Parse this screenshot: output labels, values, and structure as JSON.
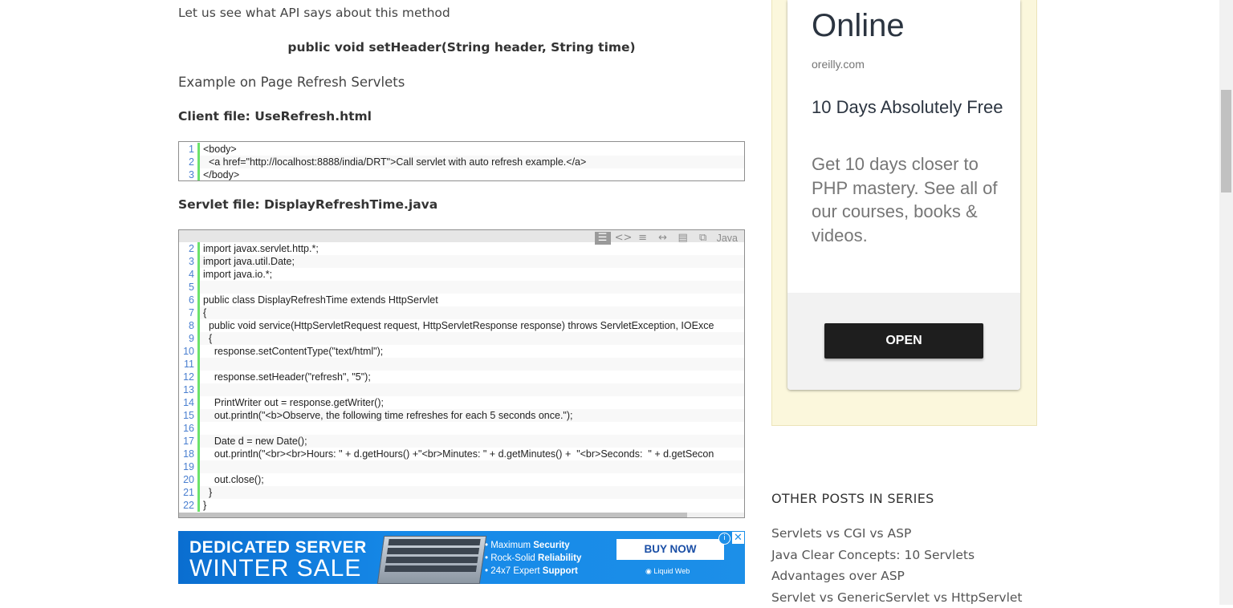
{
  "article": {
    "intro": "Let us see what API says about this method",
    "signature": "public void setHeader(String header, String time)",
    "example_heading": "Example on Page Refresh Servlets",
    "client_heading": "Client file: UseRefresh.html",
    "servlet_heading": "Servlet file: DisplayRefreshTime.java"
  },
  "client_code": [
    {
      "n": "1",
      "text": "<body>"
    },
    {
      "n": "2",
      "text": "  <a href=\"http://localhost:8888/india/DRT\">Call servlet with auto refresh example.</a>"
    },
    {
      "n": "3",
      "text": "</body>"
    }
  ],
  "servlet_toolbar": {
    "language": "Java",
    "icons": [
      "view-source-icon",
      "code-icon",
      "wrap-icon",
      "expand-icon",
      "copy-icon",
      "popup-icon"
    ]
  },
  "servlet_code": [
    {
      "n": "2",
      "text": "import javax.servlet.http.*;"
    },
    {
      "n": "3",
      "text": "import java.util.Date;"
    },
    {
      "n": "4",
      "text": "import java.io.*;"
    },
    {
      "n": "5",
      "text": ""
    },
    {
      "n": "6",
      "text": "public class DisplayRefreshTime extends HttpServlet"
    },
    {
      "n": "7",
      "text": "{"
    },
    {
      "n": "8",
      "text": "  public void service(HttpServletRequest request, HttpServletResponse response) throws ServletException, IOExce"
    },
    {
      "n": "9",
      "text": "  {"
    },
    {
      "n": "10",
      "text": "    response.setContentType(\"text/html\");"
    },
    {
      "n": "11",
      "text": ""
    },
    {
      "n": "12",
      "text": "    response.setHeader(\"refresh\", \"5\");"
    },
    {
      "n": "13",
      "text": ""
    },
    {
      "n": "14",
      "text": "    PrintWriter out = response.getWriter();"
    },
    {
      "n": "15",
      "text": "    out.println(\"<b>Observe, the following time refreshes for each 5 seconds once.\");"
    },
    {
      "n": "16",
      "text": ""
    },
    {
      "n": "17",
      "text": "    Date d = new Date();"
    },
    {
      "n": "18",
      "text": "    out.println(\"<br><br>Hours: \" + d.getHours() +\"<br>Minutes: \" + d.getMinutes() +  \"<br>Seconds:  \" + d.getSecon"
    },
    {
      "n": "19",
      "text": ""
    },
    {
      "n": "20",
      "text": "    out.close();"
    },
    {
      "n": "21",
      "text": "  }"
    },
    {
      "n": "22",
      "text": "}"
    }
  ],
  "ad_banner": {
    "title_line1": "DEDICATED SERVER",
    "title_line2": "WINTER SALE",
    "bullet1_pre": "• Maximum ",
    "bullet1_bold": "Security",
    "bullet2_pre": "• Rock-Solid ",
    "bullet2_bold": "Reliability",
    "bullet3_pre": "• 24x7 Expert ",
    "bullet3_bold": "Support",
    "cta": "BUY NOW",
    "brand": "Liquid Web",
    "info": "i",
    "close": "✕"
  },
  "sidebar_ad": {
    "title": "Online",
    "domain": "oreilly.com",
    "headline": "10 Days Absolutely Free",
    "description": "Get 10 days closer to PHP mastery. See all of our courses, books & videos.",
    "button": "OPEN"
  },
  "series": {
    "title": "OTHER POSTS IN SERIES",
    "items": [
      "Servlets vs CGI vs ASP",
      "Java Clear Concepts: 10 Servlets Advantages over ASP",
      "Servlet vs GenericServlet vs HttpServlet"
    ]
  },
  "colors": {
    "ad_blue": "#1c8fe8",
    "line_number_blue": "#4a7fd0",
    "gutter_green": "#6ce26c",
    "sidebar_ad_bg": "#fbf7dc"
  }
}
